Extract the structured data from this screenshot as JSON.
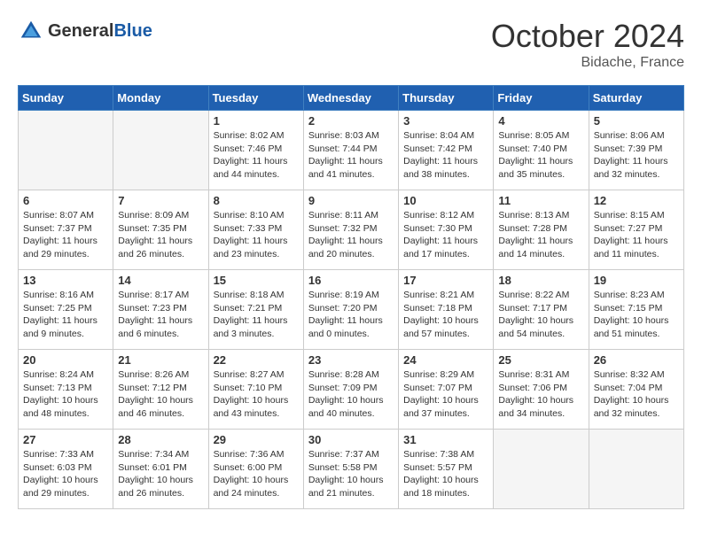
{
  "header": {
    "logo_general": "General",
    "logo_blue": "Blue",
    "month": "October 2024",
    "location": "Bidache, France"
  },
  "weekdays": [
    "Sunday",
    "Monday",
    "Tuesday",
    "Wednesday",
    "Thursday",
    "Friday",
    "Saturday"
  ],
  "weeks": [
    [
      {
        "day": "",
        "empty": true
      },
      {
        "day": "",
        "empty": true
      },
      {
        "day": "1",
        "sunrise": "Sunrise: 8:02 AM",
        "sunset": "Sunset: 7:46 PM",
        "daylight": "Daylight: 11 hours and 44 minutes."
      },
      {
        "day": "2",
        "sunrise": "Sunrise: 8:03 AM",
        "sunset": "Sunset: 7:44 PM",
        "daylight": "Daylight: 11 hours and 41 minutes."
      },
      {
        "day": "3",
        "sunrise": "Sunrise: 8:04 AM",
        "sunset": "Sunset: 7:42 PM",
        "daylight": "Daylight: 11 hours and 38 minutes."
      },
      {
        "day": "4",
        "sunrise": "Sunrise: 8:05 AM",
        "sunset": "Sunset: 7:40 PM",
        "daylight": "Daylight: 11 hours and 35 minutes."
      },
      {
        "day": "5",
        "sunrise": "Sunrise: 8:06 AM",
        "sunset": "Sunset: 7:39 PM",
        "daylight": "Daylight: 11 hours and 32 minutes."
      }
    ],
    [
      {
        "day": "6",
        "sunrise": "Sunrise: 8:07 AM",
        "sunset": "Sunset: 7:37 PM",
        "daylight": "Daylight: 11 hours and 29 minutes."
      },
      {
        "day": "7",
        "sunrise": "Sunrise: 8:09 AM",
        "sunset": "Sunset: 7:35 PM",
        "daylight": "Daylight: 11 hours and 26 minutes."
      },
      {
        "day": "8",
        "sunrise": "Sunrise: 8:10 AM",
        "sunset": "Sunset: 7:33 PM",
        "daylight": "Daylight: 11 hours and 23 minutes."
      },
      {
        "day": "9",
        "sunrise": "Sunrise: 8:11 AM",
        "sunset": "Sunset: 7:32 PM",
        "daylight": "Daylight: 11 hours and 20 minutes."
      },
      {
        "day": "10",
        "sunrise": "Sunrise: 8:12 AM",
        "sunset": "Sunset: 7:30 PM",
        "daylight": "Daylight: 11 hours and 17 minutes."
      },
      {
        "day": "11",
        "sunrise": "Sunrise: 8:13 AM",
        "sunset": "Sunset: 7:28 PM",
        "daylight": "Daylight: 11 hours and 14 minutes."
      },
      {
        "day": "12",
        "sunrise": "Sunrise: 8:15 AM",
        "sunset": "Sunset: 7:27 PM",
        "daylight": "Daylight: 11 hours and 11 minutes."
      }
    ],
    [
      {
        "day": "13",
        "sunrise": "Sunrise: 8:16 AM",
        "sunset": "Sunset: 7:25 PM",
        "daylight": "Daylight: 11 hours and 9 minutes."
      },
      {
        "day": "14",
        "sunrise": "Sunrise: 8:17 AM",
        "sunset": "Sunset: 7:23 PM",
        "daylight": "Daylight: 11 hours and 6 minutes."
      },
      {
        "day": "15",
        "sunrise": "Sunrise: 8:18 AM",
        "sunset": "Sunset: 7:21 PM",
        "daylight": "Daylight: 11 hours and 3 minutes."
      },
      {
        "day": "16",
        "sunrise": "Sunrise: 8:19 AM",
        "sunset": "Sunset: 7:20 PM",
        "daylight": "Daylight: 11 hours and 0 minutes."
      },
      {
        "day": "17",
        "sunrise": "Sunrise: 8:21 AM",
        "sunset": "Sunset: 7:18 PM",
        "daylight": "Daylight: 10 hours and 57 minutes."
      },
      {
        "day": "18",
        "sunrise": "Sunrise: 8:22 AM",
        "sunset": "Sunset: 7:17 PM",
        "daylight": "Daylight: 10 hours and 54 minutes."
      },
      {
        "day": "19",
        "sunrise": "Sunrise: 8:23 AM",
        "sunset": "Sunset: 7:15 PM",
        "daylight": "Daylight: 10 hours and 51 minutes."
      }
    ],
    [
      {
        "day": "20",
        "sunrise": "Sunrise: 8:24 AM",
        "sunset": "Sunset: 7:13 PM",
        "daylight": "Daylight: 10 hours and 48 minutes."
      },
      {
        "day": "21",
        "sunrise": "Sunrise: 8:26 AM",
        "sunset": "Sunset: 7:12 PM",
        "daylight": "Daylight: 10 hours and 46 minutes."
      },
      {
        "day": "22",
        "sunrise": "Sunrise: 8:27 AM",
        "sunset": "Sunset: 7:10 PM",
        "daylight": "Daylight: 10 hours and 43 minutes."
      },
      {
        "day": "23",
        "sunrise": "Sunrise: 8:28 AM",
        "sunset": "Sunset: 7:09 PM",
        "daylight": "Daylight: 10 hours and 40 minutes."
      },
      {
        "day": "24",
        "sunrise": "Sunrise: 8:29 AM",
        "sunset": "Sunset: 7:07 PM",
        "daylight": "Daylight: 10 hours and 37 minutes."
      },
      {
        "day": "25",
        "sunrise": "Sunrise: 8:31 AM",
        "sunset": "Sunset: 7:06 PM",
        "daylight": "Daylight: 10 hours and 34 minutes."
      },
      {
        "day": "26",
        "sunrise": "Sunrise: 8:32 AM",
        "sunset": "Sunset: 7:04 PM",
        "daylight": "Daylight: 10 hours and 32 minutes."
      }
    ],
    [
      {
        "day": "27",
        "sunrise": "Sunrise: 7:33 AM",
        "sunset": "Sunset: 6:03 PM",
        "daylight": "Daylight: 10 hours and 29 minutes."
      },
      {
        "day": "28",
        "sunrise": "Sunrise: 7:34 AM",
        "sunset": "Sunset: 6:01 PM",
        "daylight": "Daylight: 10 hours and 26 minutes."
      },
      {
        "day": "29",
        "sunrise": "Sunrise: 7:36 AM",
        "sunset": "Sunset: 6:00 PM",
        "daylight": "Daylight: 10 hours and 24 minutes."
      },
      {
        "day": "30",
        "sunrise": "Sunrise: 7:37 AM",
        "sunset": "Sunset: 5:58 PM",
        "daylight": "Daylight: 10 hours and 21 minutes."
      },
      {
        "day": "31",
        "sunrise": "Sunrise: 7:38 AM",
        "sunset": "Sunset: 5:57 PM",
        "daylight": "Daylight: 10 hours and 18 minutes."
      },
      {
        "day": "",
        "empty": true
      },
      {
        "day": "",
        "empty": true
      }
    ]
  ]
}
